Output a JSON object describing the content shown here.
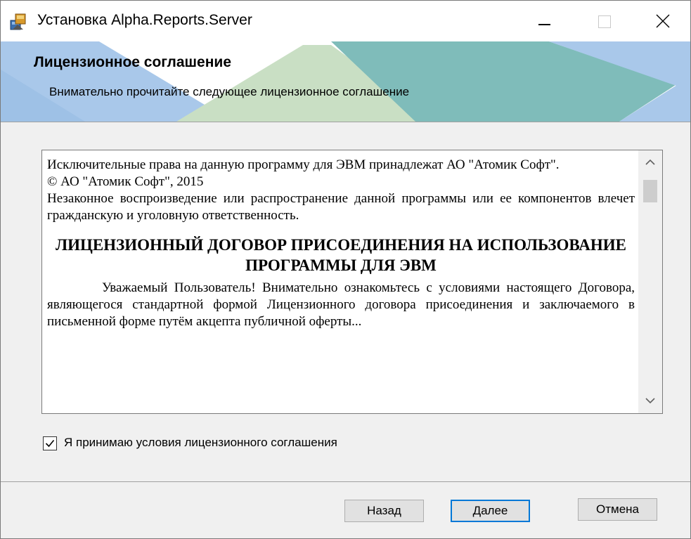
{
  "window": {
    "title": "Установка Alpha.Reports.Server",
    "icon": "installer-icon"
  },
  "banner": {
    "title": "Лицензионное соглашение",
    "subtitle": "Внимательно прочитайте следующее лицензионное соглашение"
  },
  "license": {
    "paragraphs": [
      "Исключительные права на данную программу для ЭВМ принадлежат АО \"Атомик Софт\".",
      "© АО \"Атомик Софт\", 2015",
      "Незаконное воспроизведение или распространение данной программы или ее компонентов влечет гражданскую и уголовную ответственность."
    ],
    "heading": "ЛИЦЕНЗИОННЫЙ ДОГОВОР ПРИСОЕДИНЕНИЯ НА ИСПОЛЬЗОВАНИЕ ПРОГРАММЫ ДЛЯ ЭВМ",
    "intro": "Уважаемый Пользователь! Внимательно ознакомьтесь с условиями настоящего Договора, являющегося стандартной формой Лицензионного договора присоединения и заключаемого в письменной форме путём акцепта публичной оферты..."
  },
  "accept": {
    "label": "Я принимаю условия лицензионного соглашения",
    "checked": true
  },
  "buttons": {
    "back": "Назад",
    "next": "Далее",
    "cancel": "Отмена"
  },
  "colors": {
    "accent": "#0078d7",
    "banner_teal": "#7fbcba",
    "banner_blue": "#a9c8ea",
    "banner_green": "#c9dfc4"
  }
}
